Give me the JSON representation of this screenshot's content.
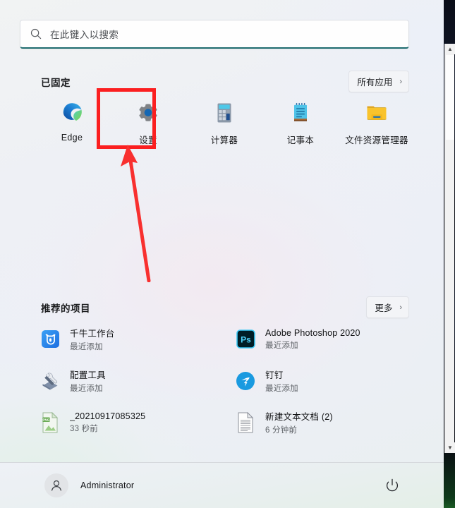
{
  "search": {
    "placeholder": "在此键入以搜索",
    "icon": "search-icon",
    "accent_color": "#1d6b6e"
  },
  "pinned": {
    "title": "已固定",
    "all_apps_label": "所有应用",
    "all_apps_chevron": "›",
    "apps": [
      {
        "label": "Edge",
        "icon": "edge-icon"
      },
      {
        "label": "设置",
        "icon": "settings-gear-icon"
      },
      {
        "label": "计算器",
        "icon": "calculator-icon"
      },
      {
        "label": "记事本",
        "icon": "notepad-icon"
      },
      {
        "label": "文件资源管理器",
        "icon": "folder-icon"
      }
    ]
  },
  "recommended": {
    "title": "推荐的项目",
    "more_label": "更多",
    "more_chevron": "›",
    "items": [
      {
        "name": "千牛工作台",
        "sub": "最近添加",
        "icon": "qianniu-icon"
      },
      {
        "name": "Adobe Photoshop 2020",
        "sub": "最近添加",
        "icon": "photoshop-icon"
      },
      {
        "name": "配置工具",
        "sub": "最近添加",
        "icon": "wrench-icon"
      },
      {
        "name": "钉钉",
        "sub": "最近添加",
        "icon": "dingtalk-icon"
      },
      {
        "name": "_20210917085325",
        "sub": "33 秒前",
        "icon": "png-file-icon"
      },
      {
        "name": "新建文本文档 (2)",
        "sub": "6 分钟前",
        "icon": "text-file-icon"
      }
    ]
  },
  "footer": {
    "account_name": "Administrator",
    "avatar_icon": "user-avatar-icon",
    "power_icon": "power-icon"
  },
  "scrollbar": {
    "up_arrow": "▲",
    "down_arrow": "▼"
  },
  "annotations": {
    "highlight_color": "#fb1f20",
    "highlight_target": "设置",
    "arrow_color": "#f8302f"
  }
}
